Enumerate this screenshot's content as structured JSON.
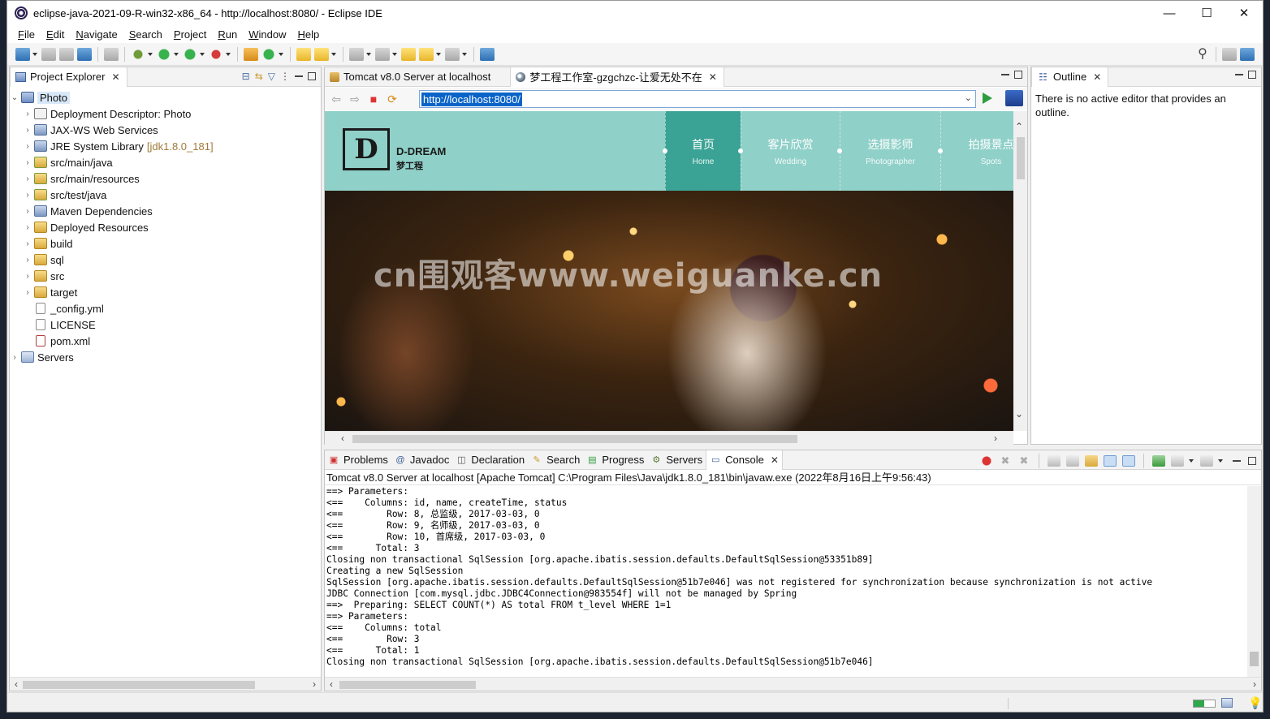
{
  "window": {
    "title": "eclipse-java-2021-09-R-win32-x86_64 - http://localhost:8080/ - Eclipse IDE",
    "minimize": "—",
    "maximize": "☐",
    "close": "✕"
  },
  "menu": [
    "File",
    "Edit",
    "Navigate",
    "Search",
    "Project",
    "Run",
    "Window",
    "Help"
  ],
  "project_explorer": {
    "tab_label": "Project Explorer",
    "root": "Photo",
    "items": [
      {
        "label": "Deployment Descriptor: Photo",
        "icon": "deployment-descriptor-icon"
      },
      {
        "label": "JAX-WS Web Services",
        "icon": "webservices-icon"
      },
      {
        "label": "JRE System Library",
        "decor": "[jdk1.8.0_181]",
        "icon": "library-icon"
      },
      {
        "label": "src/main/java",
        "icon": "source-folder-icon"
      },
      {
        "label": "src/main/resources",
        "icon": "source-folder-icon"
      },
      {
        "label": "src/test/java",
        "icon": "source-folder-icon"
      },
      {
        "label": "Maven Dependencies",
        "icon": "library-icon"
      },
      {
        "label": "Deployed Resources",
        "icon": "folder-icon"
      },
      {
        "label": "build",
        "icon": "folder-icon"
      },
      {
        "label": "sql",
        "icon": "folder-icon"
      },
      {
        "label": "src",
        "icon": "folder-icon"
      },
      {
        "label": "target",
        "icon": "folder-icon"
      },
      {
        "label": "_config.yml",
        "icon": "file-icon"
      },
      {
        "label": "LICENSE",
        "icon": "file-icon"
      },
      {
        "label": "pom.xml",
        "icon": "xml-file-icon"
      }
    ],
    "servers": "Servers"
  },
  "editor": {
    "tabs": [
      {
        "label": "Tomcat v8.0 Server at localhost"
      },
      {
        "label": "梦工程工作室-gzgchzc-让爱无处不在"
      }
    ],
    "url": "http://localhost:8080/"
  },
  "website": {
    "logo_letter": "D",
    "logo_name": "D-DREAM",
    "logo_sub": "梦工程",
    "nav": [
      {
        "zh": "首页",
        "en": "Home"
      },
      {
        "zh": "客片欣赏",
        "en": "Wedding"
      },
      {
        "zh": "选摄影师",
        "en": "Photographer"
      },
      {
        "zh": "拍摄景点",
        "en": "Spots"
      }
    ],
    "watermark": "cn围观客www.weiguanke.cn"
  },
  "outline": {
    "tab_label": "Outline",
    "message": "There is no active editor that provides an outline."
  },
  "console": {
    "tabs": [
      "Problems",
      "Javadoc",
      "Declaration",
      "Search",
      "Progress",
      "Servers",
      "Console"
    ],
    "header": "Tomcat v8.0 Server at localhost [Apache Tomcat] C:\\Program Files\\Java\\jdk1.8.0_181\\bin\\javaw.exe  (2022年8月16日上午9:56:43)",
    "lines": [
      "==> Parameters: ",
      "<==    Columns: id, name, createTime, status",
      "<==        Row: 8, 总监级, 2017-03-03, 0",
      "<==        Row: 9, 名师级, 2017-03-03, 0",
      "<==        Row: 10, 首席级, 2017-03-03, 0",
      "<==      Total: 3",
      "Closing non transactional SqlSession [org.apache.ibatis.session.defaults.DefaultSqlSession@53351b89]",
      "Creating a new SqlSession",
      "SqlSession [org.apache.ibatis.session.defaults.DefaultSqlSession@51b7e046] was not registered for synchronization because synchronization is not active",
      "JDBC Connection [com.mysql.jdbc.JDBC4Connection@983554f] will not be managed by Spring",
      "==>  Preparing: SELECT COUNT(*) AS total FROM t_level WHERE 1=1 ",
      "==> Parameters: ",
      "<==    Columns: total",
      "<==        Row: 3",
      "<==      Total: 1",
      "Closing non transactional SqlSession [org.apache.ibatis.session.defaults.DefaultSqlSession@51b7e046]"
    ]
  }
}
